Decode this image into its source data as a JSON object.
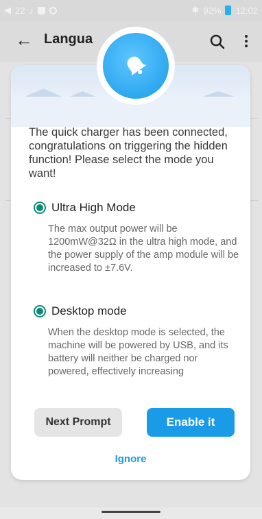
{
  "status_bar": {
    "left_text": "22",
    "battery": "92%",
    "time": "12:02"
  },
  "app_bar": {
    "back_icon": "back-arrow-icon",
    "title": "Langua",
    "search_icon": "search-icon",
    "more_icon": "more-vert-icon"
  },
  "dialog": {
    "header_icon": "bell-icon",
    "message": "The quick charger has been connected, congratulations on triggering the hidden function! Please select the mode you want!",
    "options": [
      {
        "label": "Ultra High Mode",
        "selected": true,
        "description": "The max output power will be 1200mW@32Ω in the ultra high mode, and the power supply of the amp module will be increased to ±7.6V."
      },
      {
        "label": "Desktop mode",
        "selected": true,
        "description": "When the desktop mode is selected, the machine will be powered by USB, and its battery will neither be charged nor powered, effectively increasing"
      }
    ],
    "next_prompt_label": "Next Prompt",
    "enable_label": "Enable it",
    "ignore_label": "Ignore",
    "accent_color": "#1a9be8",
    "radio_color": "#0b8a72"
  }
}
